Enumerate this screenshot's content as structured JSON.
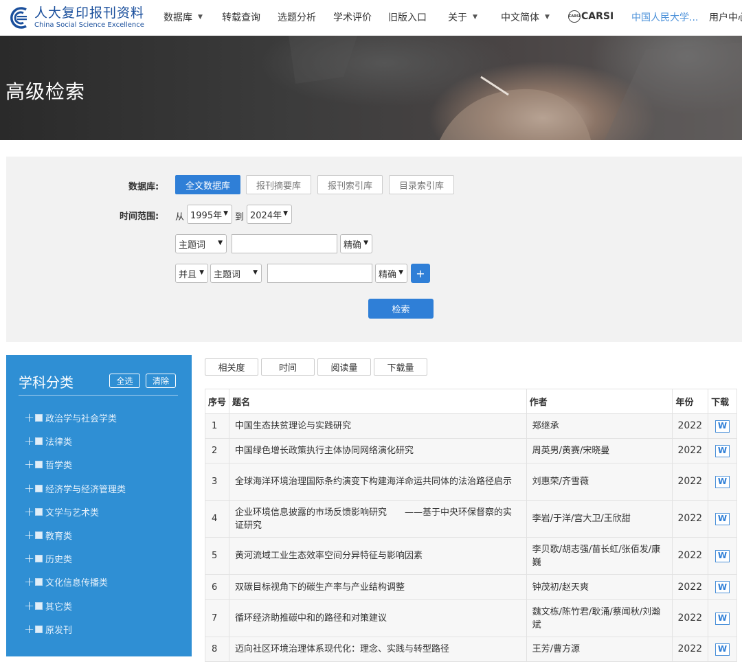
{
  "logo": {
    "cn": "人大复印报刊资料",
    "en": "China Social Science Excellence"
  },
  "nav": {
    "items": [
      "数据库",
      "转载查询",
      "选题分析",
      "学术评价",
      "旧版入口",
      "关于",
      "中文简体",
      "CARSI",
      "中国人民大学...",
      "用户中心"
    ],
    "carsi_icon_text": "CARSI"
  },
  "banner": {
    "title": "高级检索"
  },
  "search": {
    "db_label": "数据库:",
    "db_options": [
      "全文数据库",
      "报刊摘要库",
      "报刊索引库",
      "目录索引库"
    ],
    "time_label": "时间范围:",
    "from_text": "从",
    "from_year": "1995年",
    "to_text": "到",
    "to_year": "2024年",
    "row1": {
      "field": "主题词",
      "value": "",
      "match": "精确"
    },
    "row2": {
      "logic": "并且",
      "field": "主题词",
      "value": "",
      "match": "精确"
    },
    "add_label": "+",
    "submit_label": "检索"
  },
  "sidebar": {
    "title": "学科分类",
    "select_all": "全选",
    "clear": "清除",
    "items": [
      "政治学与社会学类",
      "法律类",
      "哲学类",
      "经济学与经济管理类",
      "文学与艺术类",
      "教育类",
      "历史类",
      "文化信息传播类",
      "其它类",
      "原发刊"
    ]
  },
  "sort": {
    "options": [
      "相关度",
      "时间",
      "阅读量",
      "下载量"
    ]
  },
  "table": {
    "headers": [
      "序号",
      "题名",
      "作者",
      "年份",
      "下载"
    ],
    "download_icon": "W",
    "rows": [
      {
        "no": "1",
        "title": "中国生态扶贫理论与实践研究",
        "author": "郑继承",
        "year": "2022"
      },
      {
        "no": "2",
        "title": "中国绿色增长政策执行主体协同网络演化研究",
        "author": "周英男/黄赛/宋晓曼",
        "year": "2022"
      },
      {
        "no": "3",
        "title": "全球海洋环境治理国际条约演变下构建海洋命运共同体的法治路径启示",
        "author": "刘惠荣/齐雪薇",
        "year": "2022"
      },
      {
        "no": "4",
        "title": "企业环境信息披露的市场反馈影响研究　　——基于中央环保督察的实证研究",
        "author": "李岩/于洋/宫大卫/王欣甜",
        "year": "2022"
      },
      {
        "no": "5",
        "title": "黄河流域工业生态效率空间分异特征与影响因素",
        "author": "李贝歌/胡志强/苗长虹/张佰发/康巍",
        "year": "2022"
      },
      {
        "no": "6",
        "title": "双碳目标视角下的碳生产率与产业结构调整",
        "author": "钟茂初/赵天爽",
        "year": "2022"
      },
      {
        "no": "7",
        "title": "循环经济助推碳中和的路径和对策建议",
        "author": "魏文栋/陈竹君/耿涌/蔡闻秋/刘瀚斌",
        "year": "2022"
      },
      {
        "no": "8",
        "title": "迈向社区环境治理体系现代化：理念、实践与转型路径",
        "author": "王芳/曹方源",
        "year": "2022"
      }
    ]
  },
  "colors": {
    "accent": "#2f7fd7",
    "sidebar_bg": "#2f8fd4",
    "brand": "#1a4f9c"
  }
}
